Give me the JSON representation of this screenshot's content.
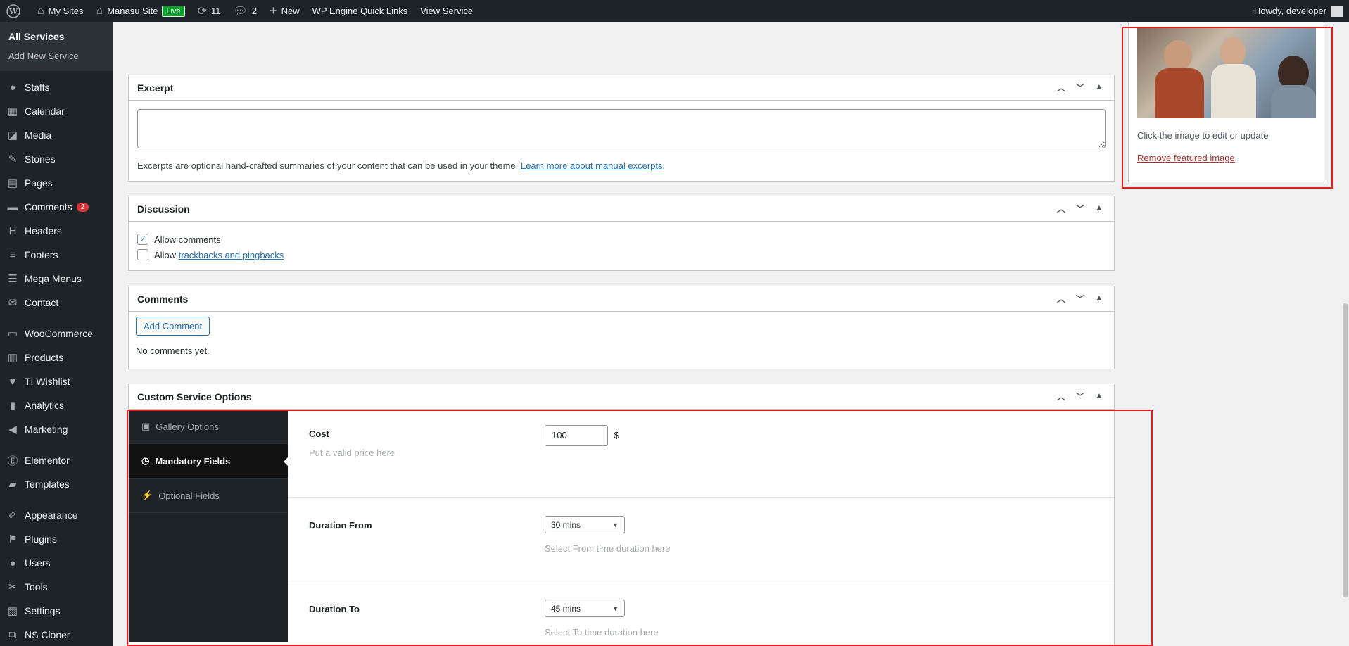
{
  "adminbar": {
    "my_sites": "My Sites",
    "site_name": "Manasu Site",
    "live_label": "Live",
    "updates_count": "11",
    "comments_count": "2",
    "new_label": "New",
    "wp_engine": "WP Engine Quick Links",
    "view_service": "View Service",
    "howdy": "Howdy, developer"
  },
  "sidebar": {
    "submenu": [
      "All Services",
      "Add New Service"
    ],
    "items": [
      {
        "label": "Staffs",
        "icon": "user-icon"
      },
      {
        "label": "Calendar",
        "icon": "calendar-icon"
      },
      {
        "label": "Media",
        "icon": "media-icon"
      },
      {
        "label": "Stories",
        "icon": "stories-icon"
      },
      {
        "label": "Pages",
        "icon": "pages-icon"
      },
      {
        "label": "Comments",
        "icon": "comment-icon",
        "badge": "2"
      },
      {
        "label": "Headers",
        "icon": "header-icon"
      },
      {
        "label": "Footers",
        "icon": "footer-icon"
      },
      {
        "label": "Mega Menus",
        "icon": "menu-icon"
      },
      {
        "label": "Contact",
        "icon": "mail-icon"
      },
      {
        "label": "WooCommerce",
        "icon": "woo-icon"
      },
      {
        "label": "Products",
        "icon": "products-icon"
      },
      {
        "label": "TI Wishlist",
        "icon": "heart-icon"
      },
      {
        "label": "Analytics",
        "icon": "analytics-icon"
      },
      {
        "label": "Marketing",
        "icon": "megaphone-icon"
      },
      {
        "label": "Elementor",
        "icon": "elementor-icon"
      },
      {
        "label": "Templates",
        "icon": "folder-icon"
      },
      {
        "label": "Appearance",
        "icon": "brush-icon"
      },
      {
        "label": "Plugins",
        "icon": "plugin-icon"
      },
      {
        "label": "Users",
        "icon": "users-icon"
      },
      {
        "label": "Tools",
        "icon": "wrench-icon"
      },
      {
        "label": "Settings",
        "icon": "settings-icon"
      },
      {
        "label": "NS Cloner",
        "icon": "clone-icon"
      }
    ]
  },
  "excerpt": {
    "title": "Excerpt",
    "value": "",
    "hint": "Excerpts are optional hand-crafted summaries of your content that can be used in your theme.",
    "link": "Learn more about manual excerpts",
    "hint_end": "."
  },
  "discussion": {
    "title": "Discussion",
    "allow_comments": "Allow comments",
    "allow_prefix": "Allow",
    "trackbacks_link": "trackbacks and pingbacks"
  },
  "comments": {
    "title": "Comments",
    "add_button": "Add Comment",
    "empty": "No comments yet."
  },
  "cso": {
    "title": "Custom Service Options",
    "tabs": [
      "Gallery Options",
      "Mandatory Fields",
      "Optional Fields"
    ],
    "cost_label": "Cost",
    "cost_desc": "Put a valid price here",
    "cost_value": "100",
    "currency": "$",
    "from_label": "Duration From",
    "from_value": "30 mins",
    "from_desc": "Select From time duration here",
    "to_label": "Duration To",
    "to_value": "45 mins",
    "to_desc": "Select To time duration here"
  },
  "featured": {
    "click_hint": "Click the image to edit or update",
    "remove_link": "Remove featured image"
  }
}
